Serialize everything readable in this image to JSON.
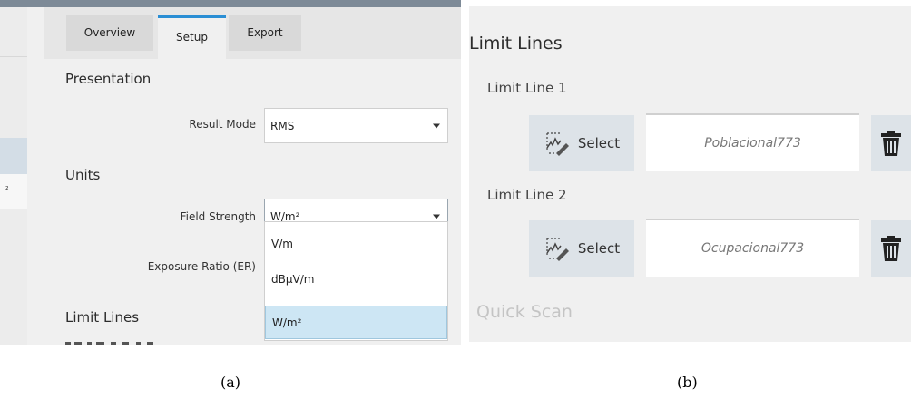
{
  "panel_a": {
    "left_strip": {
      "superscript": "²"
    },
    "tabs": [
      {
        "label": "Overview",
        "active": false
      },
      {
        "label": "Setup",
        "active": true
      },
      {
        "label": "Export",
        "active": false
      }
    ],
    "sections": {
      "presentation": "Presentation",
      "units": "Units",
      "limit_lines": "Limit Lines"
    },
    "result_mode": {
      "label": "Result Mode",
      "value": "RMS"
    },
    "field_strength": {
      "label": "Field Strength",
      "value": "W/m²",
      "options": [
        "V/m",
        "dBµV/m",
        "W/m²"
      ],
      "selected_option": "W/m²"
    },
    "exposure_ratio": {
      "label": "Exposure Ratio (ER)"
    }
  },
  "panel_b": {
    "title": "Limit Lines",
    "limit_line_1": {
      "label": "Limit Line 1",
      "select_label": "Select",
      "name": "Poblacional773"
    },
    "limit_line_2": {
      "label": "Limit Line 2",
      "select_label": "Select",
      "name": "Ocupacional773"
    },
    "quick_scan": "Quick Scan"
  },
  "captions": {
    "a": "(a)",
    "b": "(b)"
  },
  "colors": {
    "active_tab_bar": "#2a8ed4",
    "selected_option_bg": "#cde6f4",
    "button_bg": "#dde3e8"
  },
  "icons": [
    "chevron-down-icon",
    "limit-line-select-icon",
    "trash-icon"
  ]
}
